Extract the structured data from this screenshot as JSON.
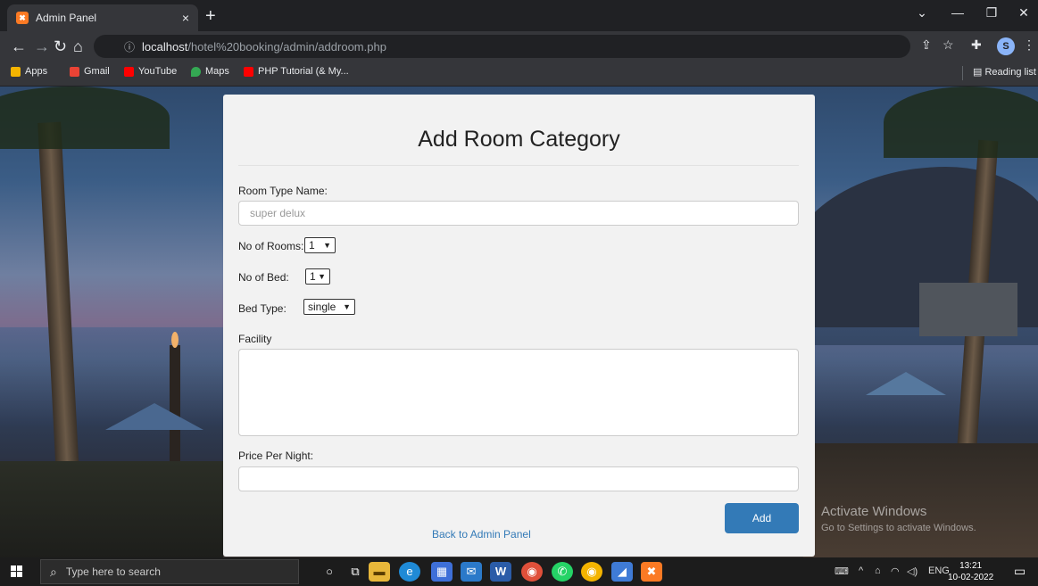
{
  "browser": {
    "tab_title": "Admin Panel",
    "tab_close": "×",
    "new_tab": "+",
    "url_host": "localhost",
    "url_path": "/hotel%20booking/admin/addroom.php",
    "profile_letter": "S",
    "bookmarks": [
      {
        "label": "Apps",
        "color": "#f4b400"
      },
      {
        "label": "Gmail",
        "color": "#ea4335"
      },
      {
        "label": "YouTube",
        "color": "#ff0000"
      },
      {
        "label": "Maps",
        "color": "#34a853"
      },
      {
        "label": "PHP Tutorial (& My...",
        "color": "#ff0000"
      }
    ],
    "reading_list": "Reading list"
  },
  "form": {
    "title": "Add Room Category",
    "room_type_label": "Room Type Name:",
    "room_type_placeholder": "super delux",
    "rooms_label": "No of Rooms:",
    "rooms_value": "1",
    "bed_label": "No of Bed:",
    "bed_value": "1",
    "bed_type_label": "Bed Type:",
    "bed_type_value": "single",
    "facility_label": "Facility",
    "price_label": "Price Per Night:",
    "add_button": "Add",
    "back_link": "Back to Admin Panel"
  },
  "watermark": {
    "line1": "Activate Windows",
    "line2": "Go to Settings to activate Windows."
  },
  "taskbar": {
    "search_placeholder": "Type here to search",
    "language": "ENG",
    "time": "13:21",
    "date": "10-02-2022"
  }
}
